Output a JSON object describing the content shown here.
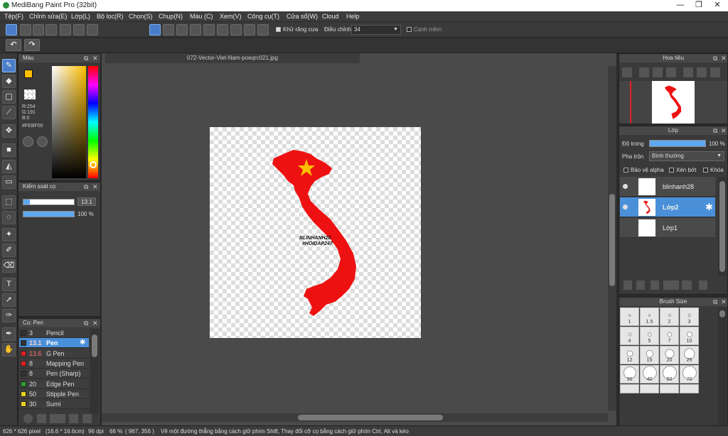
{
  "app": {
    "title": "MediBang Paint Pro (32bit)"
  },
  "menu": [
    "Tệp(F)",
    "Chỉnh sửa(E)",
    "Lớp(L)",
    "Bộ lọc(R)",
    "Chọn(S)",
    "Chụp(N)",
    "Màu (C)",
    "Xem(V)",
    "Công cụ(T)",
    "Cửa sổ(W)",
    "Cloud",
    "Help"
  ],
  "toolbar": {
    "antialias_label": "Khử răng cưa",
    "adjust_label": "Điều chỉnh",
    "adjust_value": "34",
    "soft_edge_label": "Cạnh mềm"
  },
  "canvas": {
    "filename": "072-Vector-Viet-Nam-poeqrc021.jpg"
  },
  "color_panel": {
    "title": "Màu",
    "r": "R:254",
    "g": "G:191",
    "b": "B:0",
    "hex": "#FEBF00",
    "primary": "#FEBF00",
    "secondary": "#F5B5C8"
  },
  "brush_control": {
    "title": "Kiểm soát cọ",
    "size_value": "13.1",
    "opacity_value": "100 %",
    "size_fraction": 0.13,
    "opacity_fraction": 1.0
  },
  "brush_panel": {
    "title": "Cọ: Pen",
    "items": [
      {
        "size": "3",
        "name": "Pencil",
        "color": "#333333"
      },
      {
        "size": "13.1",
        "name": "Pen",
        "color": "#333333"
      },
      {
        "size": "13.6",
        "name": "G Pen",
        "color": "#e02020"
      },
      {
        "size": "8",
        "name": "Mapping Pen",
        "color": "#e02020"
      },
      {
        "size": "8",
        "name": "Pen (Sharp)",
        "color": "#333333"
      },
      {
        "size": "20",
        "name": "Edge Pen",
        "color": "#2aa02a"
      },
      {
        "size": "50",
        "name": "Stipple Pen",
        "color": "#e8d020"
      },
      {
        "size": "30",
        "name": "Sumi",
        "color": "#e8d020"
      }
    ]
  },
  "navigator": {
    "title": "Hoa tiêu"
  },
  "layer_panel": {
    "title": "Lớp",
    "opacity_label": "Độ trong",
    "opacity_value": "100 %",
    "blend_label": "Pha trộn",
    "blend_value": "Bình thường",
    "protect_alpha": "Bảo vệ alpha",
    "clipping": "Xén bớt",
    "lock": "Khóa",
    "layers": [
      {
        "name": "blinhanh28"
      },
      {
        "name": "Lớp2"
      },
      {
        "name": "Lớp1"
      }
    ]
  },
  "brush_size": {
    "title": "Brush Size",
    "sizes": [
      "1",
      "1.5",
      "2",
      "3",
      "4",
      "5",
      "7",
      "10",
      "12",
      "15",
      "20",
      "25",
      "30",
      "40",
      "50",
      "70"
    ]
  },
  "watermark": {
    "line1": "BLINHANH28",
    "line2": "#HOIDAP247"
  },
  "status": {
    "dimensions": "626 * 626 pixel",
    "size_cm": "(16.6 * 16.6cm)",
    "dpi": "96 dpi",
    "zoom": "66 %",
    "coords": "( 967, 356 )",
    "hint": "Vẽ một đường thẳng bằng cách giữ phím Shift, Thay đổi cỡ cọ bằng cách giữ phím Ctrl, Alt và kéo"
  },
  "colors": {
    "accent": "#4a90d9",
    "flag_red": "#ee1111",
    "star_yellow": "#FEBF00"
  }
}
